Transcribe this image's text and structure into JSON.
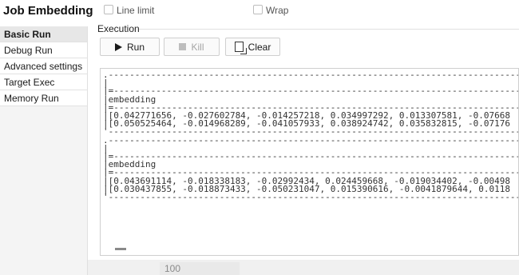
{
  "app": {
    "title": "Job Embedding"
  },
  "tabs": [
    {
      "label": "Basic Run",
      "active": true
    },
    {
      "label": "Debug Run",
      "active": false
    },
    {
      "label": "Advanced settings",
      "active": false
    },
    {
      "label": "Target Exec",
      "active": false
    },
    {
      "label": "Memory Run",
      "active": false
    }
  ],
  "execution": {
    "section_label": "Execution",
    "run_label": "Run",
    "kill_label": "Kill",
    "clear_label": "Clear"
  },
  "console": {
    "lines": [
      ".-------------------------------------------------------------------------------------.",
      "|",
      "|=-----------------------------------------------------------------------------------=|",
      "|embedding",
      "|=-----------------------------------------------------------------------------------=|",
      "|[0.042771656, -0.027602784, -0.014257218, 0.034997292, 0.013307581, -0.07668",
      "|[0.050525464, -0.014968289, -0.041057933, 0.038924742, 0.035832815, -0.07176",
      "'-------------------------------------------------------------------------------------'",
      ".-------------------------------------------------------------------------------------.",
      "|",
      "|=-----------------------------------------------------------------------------------=|",
      "|embedding",
      "|=-----------------------------------------------------------------------------------=|",
      "|[0.043691114, -0.018338183, -0.02992434, 0.024459668, -0.019034402, -0.00498",
      "|[0.030437855, -0.018873433, -0.050231047, 0.015390616, -0.0041879644, 0.0118",
      "'-------------------------------------------------------------------------------------'"
    ]
  },
  "options": {
    "line_limit_label": "Line limit",
    "line_limit_value": "100",
    "wrap_label": "Wrap"
  }
}
